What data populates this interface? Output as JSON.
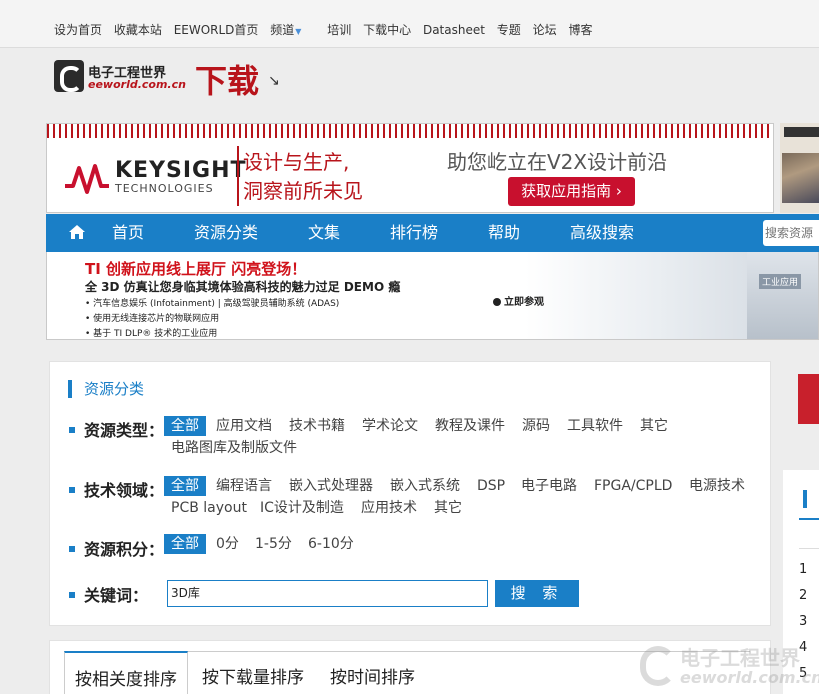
{
  "topbar": {
    "links": [
      "设为首页",
      "收藏本站",
      "EEWORLD首页",
      "频道",
      "培训",
      "下载中心",
      "Datasheet",
      "专题",
      "论坛",
      "博客"
    ]
  },
  "header": {
    "logo_cn": "电子工程世界",
    "logo_en": "eeworld.com.cn",
    "title": "下载",
    "arrow": "↘"
  },
  "ad_banner": {
    "brand": "KEYSIGHT",
    "brand_sub": "TECHNOLOGIES",
    "slogan_line1": "设计与生产,",
    "slogan_line2": "洞察前所未见",
    "headline": "助您屹立在V2X设计前沿",
    "cta": "获取应用指南 ›"
  },
  "nav": {
    "items": [
      "首页",
      "资源分类",
      "文集",
      "排行榜",
      "帮助",
      "高级搜索"
    ],
    "search_placeholder": "搜索资源"
  },
  "promo": {
    "title": "TI 创新应用线上展厅  闪亮登场！",
    "subtitle": "全 3D 仿真让您身临其境体验高科技的魅力过足 DEMO 瘾",
    "bullets": [
      "汽车信息娱乐 (Infotainment) | 高级驾驶员辅助系统 (ADAS)",
      "使用无线连接芯片的物联网应用",
      "基于 TI DLP® 技术的工业应用"
    ],
    "watch": "立即参观",
    "machine_label": "工业应用"
  },
  "filter": {
    "title": "资源分类",
    "type_label": "资源类型：",
    "type_options": [
      "全部",
      "应用文档",
      "技术书籍",
      "学术论文",
      "教程及课件",
      "源码",
      "工具软件",
      "其它",
      "电路图库及制版文件"
    ],
    "domain_label": "技术领域：",
    "domain_options": [
      "全部",
      "编程语言",
      "嵌入式处理器",
      "嵌入式系统",
      "DSP",
      "电子电路",
      "FPGA/CPLD",
      "电源技术",
      "PCB layout",
      "IC设计及制造",
      "应用技术",
      "其它"
    ],
    "points_label": "资源积分：",
    "points_options": [
      "全部",
      "0分",
      "1-5分",
      "6-10分"
    ],
    "keyword_label": "关键词：",
    "keyword_value": "3D库",
    "search_button": "搜 索"
  },
  "sort": {
    "tabs": [
      "按相关度排序",
      "按下载量排序",
      "按时间排序"
    ]
  },
  "rank_numbers": [
    "1",
    "2",
    "3",
    "4",
    "5"
  ],
  "watermark": {
    "cn": "电子工程世界",
    "en": "eeworld.com.cn"
  },
  "colors": {
    "primary": "#1a7fc7",
    "accent_red": "#b8141b"
  }
}
